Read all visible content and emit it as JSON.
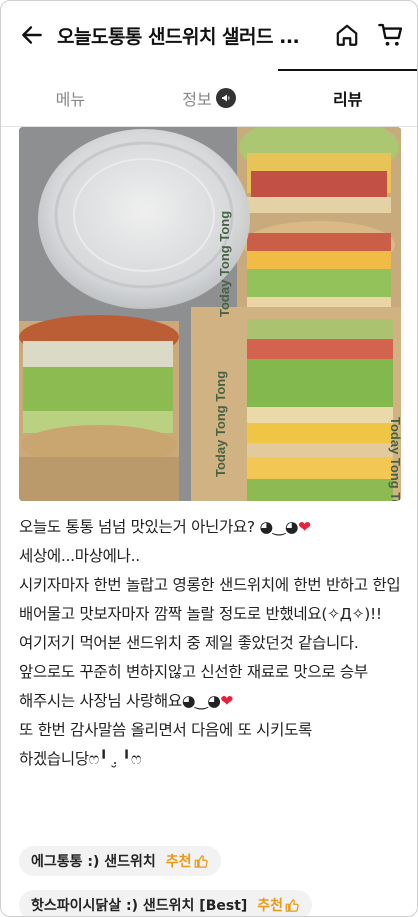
{
  "header": {
    "title": "오늘도통통 샌드위치 샐러드 ...",
    "back_icon": "arrow-left-icon",
    "home_icon": "home-icon",
    "cart_icon": "cart-icon"
  },
  "tabs": [
    {
      "label": "메뉴",
      "active": false
    },
    {
      "label": "정보",
      "active": false,
      "icon": "megaphone-icon"
    },
    {
      "label": "리뷰",
      "active": true
    }
  ],
  "photo": {
    "wrapper_text_1": "Today Tong Tong",
    "wrapper_text_2": "Today Tong Tong",
    "wrapper_text_3": "Today Tong Tong"
  },
  "review": {
    "lines": [
      "오늘도 통통  넘넘 맛있는거 아닌가요? ◕‿◕",
      "세상에...마상에나..",
      "시키자마자 한번 놀랍고 영롱한 샌드위치에 한번 반하고 한입  배어물고 맛보자마자 깜짝 놀랄 정도로 반했네요(✧Д✧)!!",
      "여기저기 먹어본 샌드위치 중 제일 좋았던것 같습니다.",
      "앞으로도  꾸준히  변하지않고 신선한 재료로  맛으로 승부 해주시는 사장님 사랑해요◕‿◕",
      "또 한번 감사말씀 올리면서  다음에 또 시키도록 하겠습니당ෆ╹ .̮ ╹ෆ"
    ],
    "heart": "❤"
  },
  "tags": [
    {
      "name": "에그통통 :) 샌드위치",
      "rec": "추천"
    },
    {
      "name": "핫스파이시닭살 :) 샌드위치 [Best]",
      "rec": "추천"
    }
  ],
  "colors": {
    "accent": "#e69a1a",
    "heart": "#e8203a"
  }
}
